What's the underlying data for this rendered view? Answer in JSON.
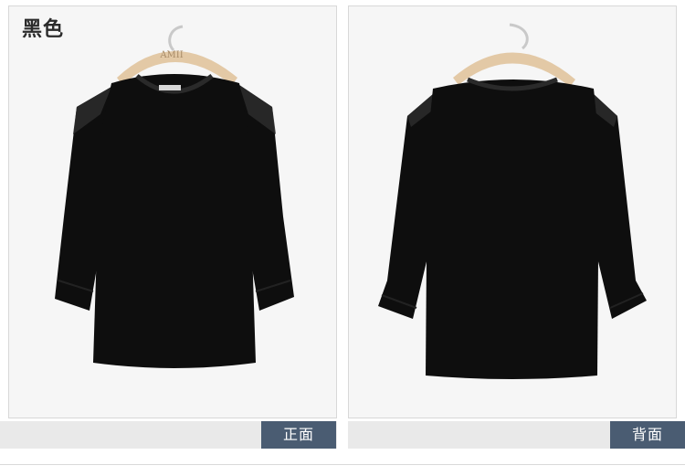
{
  "color_label": "黑色",
  "views": {
    "front_label": "正面",
    "back_label": "背面"
  },
  "hanger_text": "AMII",
  "colors": {
    "garment": "#0e0e0e",
    "hanger": "#e3c9a6",
    "panel_bg": "#f6f6f6",
    "tag_bg": "#4a5c72",
    "bar_bg": "#e9e9e9"
  }
}
